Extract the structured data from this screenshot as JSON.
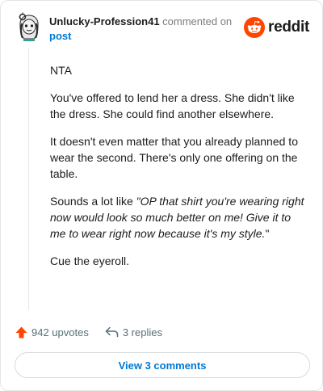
{
  "header": {
    "username": "Unlucky-Profession41",
    "commented_text": "commented on",
    "post_link": "post",
    "logo_text": "reddit"
  },
  "comment": {
    "paragraphs": [
      {
        "text": "NTA"
      },
      {
        "text": "You've offered to lend her a dress. She didn't like the dress. She could find another elsewhere."
      },
      {
        "text": "It doesn't even matter that you already planned to wear the second. There's only one offering on the table."
      }
    ],
    "quote_intro": "Sounds a lot like ",
    "quote_text": "\"OP that shirt you're wearing right now would look so much better on me! Give it to me to wear right now because it's my style.",
    "quote_end": "\"",
    "closing": "Cue the eyeroll."
  },
  "actions": {
    "upvotes": "942 upvotes",
    "replies": "3 replies"
  },
  "view_button": "View 3 comments",
  "colors": {
    "upvote": "#ff4500",
    "link": "#0079d3",
    "reddit_orange": "#ff4500"
  }
}
